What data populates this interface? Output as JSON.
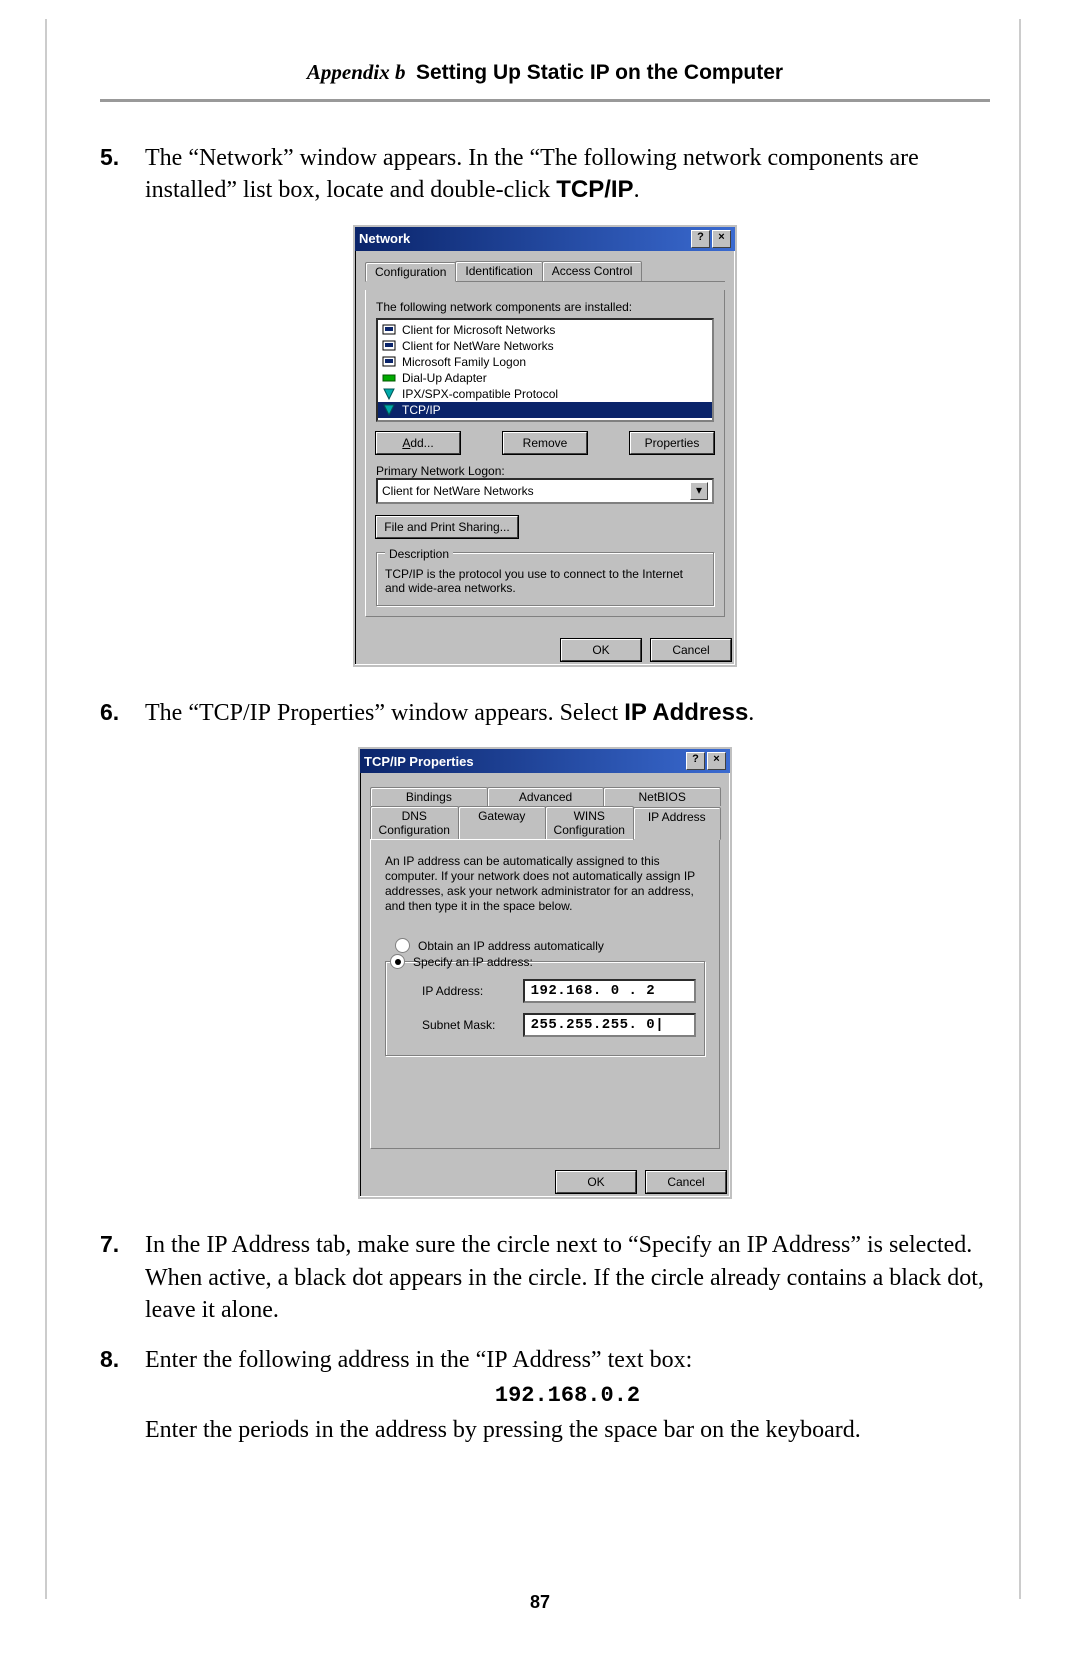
{
  "header": {
    "appendix": "Appendix b",
    "chapter_title": "Setting Up Static IP on the Computer"
  },
  "page_number": "87",
  "steps": {
    "s5": {
      "num": "5.",
      "text_a": "The “Network” window appears. In the “The following network components are installed” list box, locate and double-click ",
      "bold": "TCP/IP",
      "text_b": "."
    },
    "s6": {
      "num": "6.",
      "text_a": "The “",
      "sc1": "TCP/IP",
      "text_b": " Properties” window appears. Select ",
      "bold": "IP Address",
      "text_c": "."
    },
    "s7": {
      "num": "7.",
      "text": "In the IP Address tab, make sure the circle next to “Specify an IP Address” is selected. When active, a black dot appears in the circle. If the circle already contains a black dot, leave it alone."
    },
    "s8": {
      "num": "8.",
      "text_a": "Enter the following address in the “",
      "sc1": "IP",
      "text_b": " Address” text box:",
      "code": "192.168.0.2",
      "text_c": "Enter the periods in the address by pressing the space bar on the keyboard."
    }
  },
  "dlg1": {
    "title": "Network",
    "tabs": [
      "Configuration",
      "Identification",
      "Access Control"
    ],
    "list_label": "The following network components are installed:",
    "items": [
      "Client for Microsoft Networks",
      "Client for NetWare Networks",
      "Microsoft Family Logon",
      "Dial-Up Adapter",
      "IPX/SPX-compatible Protocol",
      "TCP/IP"
    ],
    "btns": {
      "add": "Add...",
      "remove": "Remove",
      "props": "Properties"
    },
    "logon_label": "Primary Network Logon:",
    "logon_value": "Client for NetWare Networks",
    "file_share": "File and Print Sharing...",
    "desc_title": "Description",
    "desc_text": "TCP/IP is the protocol you use to connect to the Internet and wide-area networks.",
    "ok": "OK",
    "cancel": "Cancel"
  },
  "dlg2": {
    "title": "TCP/IP Properties",
    "tabs_row1": [
      "Bindings",
      "Advanced",
      "NetBIOS"
    ],
    "tabs_row2": [
      "DNS Configuration",
      "Gateway",
      "WINS Configuration",
      "IP Address"
    ],
    "info": "An IP address can be automatically assigned to this computer. If your network does not automatically assign IP addresses, ask your network administrator for an address, and then type it in the space below.",
    "radio_auto": "Obtain an IP address automatically",
    "radio_spec": "Specify an IP address:",
    "ip_label": "IP Address:",
    "ip_value": "192.168. 0 . 2",
    "mask_label": "Subnet Mask:",
    "mask_value": "255.255.255. 0|",
    "ok": "OK",
    "cancel": "Cancel"
  }
}
